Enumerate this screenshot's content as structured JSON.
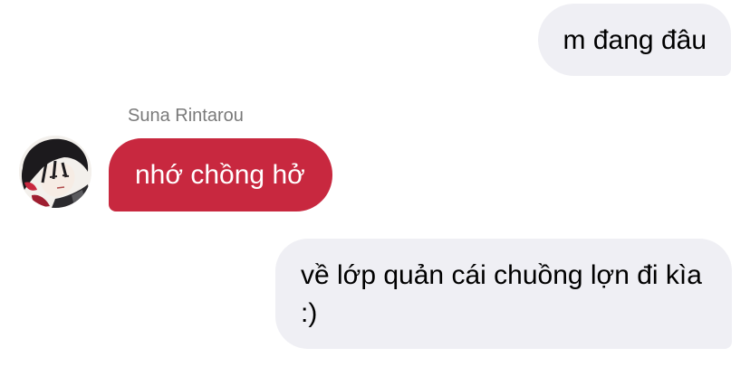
{
  "conversation": {
    "messages": [
      {
        "direction": "outgoing",
        "text": "m đang đâu"
      },
      {
        "direction": "incoming",
        "sender": "Suna Rintarou",
        "text": "nhớ chồng hở"
      },
      {
        "direction": "outgoing",
        "text": "về lớp quản cái chuồng lợn đi kìa :)"
      }
    ]
  },
  "colors": {
    "outgoing_bubble": "#efeff4",
    "incoming_bubble": "#c8283f",
    "sender_name": "#7a7a7a"
  }
}
